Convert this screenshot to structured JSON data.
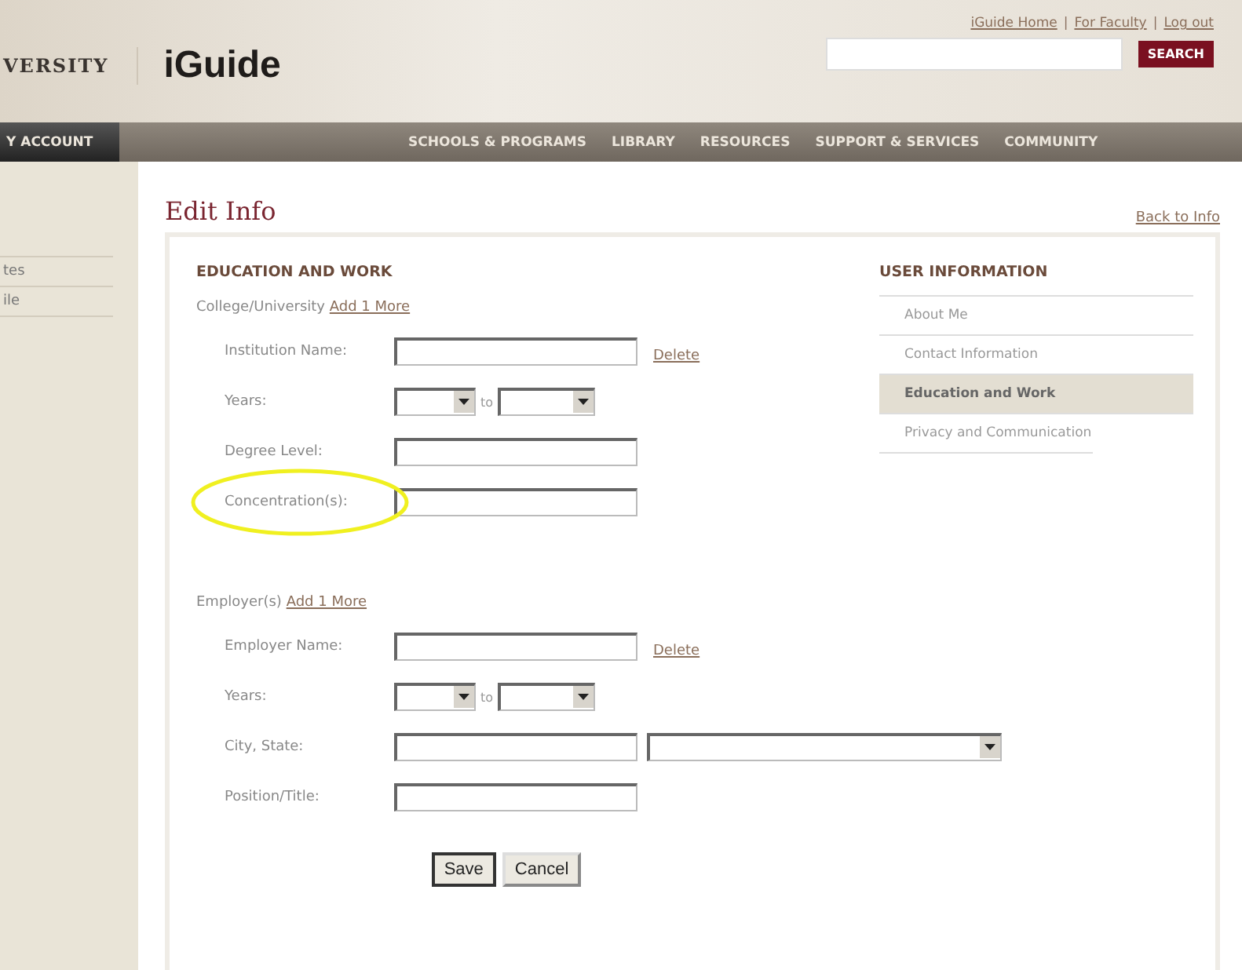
{
  "header": {
    "logo_text": "VERSITY",
    "brand": "iGuide",
    "top_links": [
      "iGuide Home",
      "For Faculty",
      "Log out"
    ],
    "separator": "|",
    "search_button": "SEARCH"
  },
  "nav": [
    {
      "label": "Y ACCOUNT",
      "selected": true
    },
    {
      "label": "SCHOOLS & PROGRAMS",
      "selected": false
    },
    {
      "label": "LIBRARY",
      "selected": false
    },
    {
      "label": "RESOURCES",
      "selected": false
    },
    {
      "label": "SUPPORT & SERVICES",
      "selected": false
    },
    {
      "label": "COMMUNITY",
      "selected": false
    }
  ],
  "sidebar": {
    "items": [
      "tes",
      "ile"
    ]
  },
  "page_title": "Edit Info",
  "back_link": "Back to Info",
  "form": {
    "heading": "EDUCATION AND WORK",
    "groups": [
      {
        "label": "College/University",
        "add_link": "Add 1 More",
        "fields": [
          {
            "kind": "text",
            "label": "Institution Name:",
            "delete": "Delete"
          },
          {
            "kind": "years",
            "label": "Years:",
            "separator": "to"
          },
          {
            "kind": "text",
            "label": "Degree Level:"
          },
          {
            "kind": "text",
            "label": "Concentration(s):",
            "highlighted": true
          }
        ]
      },
      {
        "label": "Employer(s)",
        "add_link": "Add 1 More",
        "fields": [
          {
            "kind": "text",
            "label": "Employer Name:",
            "delete": "Delete"
          },
          {
            "kind": "years",
            "label": "Years:",
            "separator": "to"
          },
          {
            "kind": "text_select",
            "label": "City, State:"
          },
          {
            "kind": "text",
            "label": "Position/Title:"
          }
        ]
      }
    ],
    "buttons": [
      {
        "label": "Save",
        "kind": "default"
      },
      {
        "label": "Cancel",
        "kind": "normal"
      }
    ]
  },
  "user_info": {
    "heading": "USER INFORMATION",
    "items": [
      {
        "label": "About Me",
        "selected": false
      },
      {
        "label": "Contact Information",
        "selected": false
      },
      {
        "label": "Education and Work",
        "selected": true
      },
      {
        "label": "Privacy and Communication",
        "selected": false
      }
    ]
  }
}
